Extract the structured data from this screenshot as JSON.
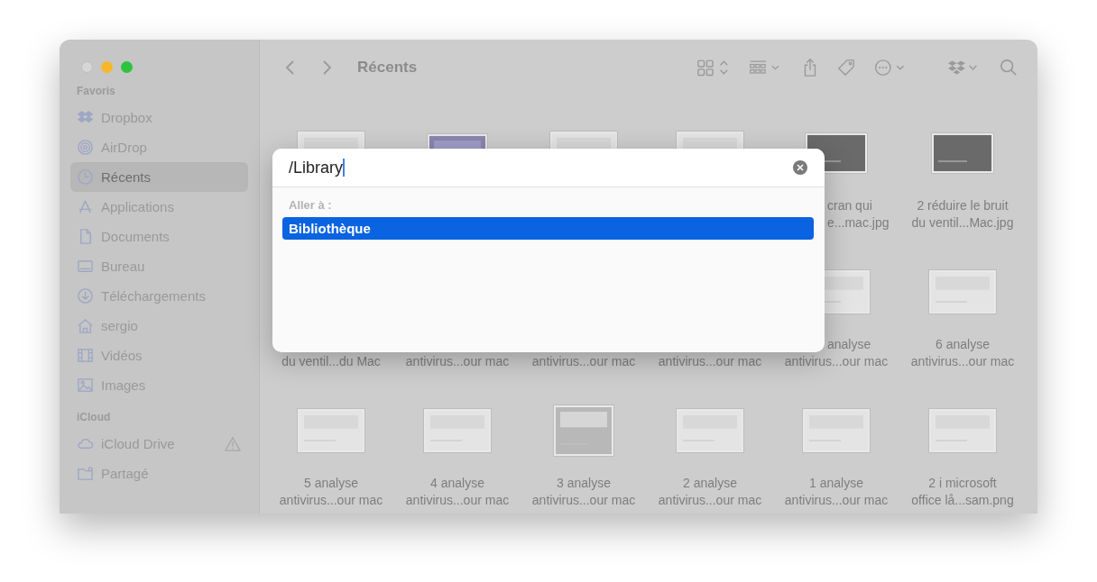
{
  "window": {
    "title": "Récents"
  },
  "sidebar": {
    "sections": [
      {
        "header": "Favoris",
        "items": [
          {
            "label": "Dropbox",
            "selected": false
          },
          {
            "label": "AirDrop",
            "selected": false
          },
          {
            "label": "Récents",
            "selected": true
          },
          {
            "label": "Applications",
            "selected": false
          },
          {
            "label": "Documents",
            "selected": false
          },
          {
            "label": "Bureau",
            "selected": false
          },
          {
            "label": "Téléchargements",
            "selected": false
          },
          {
            "label": "sergio",
            "selected": false
          },
          {
            "label": "Vidéos",
            "selected": false
          },
          {
            "label": "Images",
            "selected": false
          }
        ]
      },
      {
        "header": "iCloud",
        "items": [
          {
            "label": "iCloud Drive",
            "selected": false,
            "warning": true
          },
          {
            "label": "Partagé",
            "selected": false
          }
        ]
      }
    ]
  },
  "files": [
    {
      "kind": "doc"
    },
    {
      "kind": "purple"
    },
    {
      "kind": "doc"
    },
    {
      "kind": "doc"
    },
    {
      "kind": "dark",
      "line1": {
        "text": "cran qui",
        "cut_left": true
      },
      "line2": {
        "text": "e...mac.jpg",
        "cut_left": true
      }
    },
    {
      "kind": "dark",
      "line1": {
        "text": "2 réduire le bruit"
      },
      "line2": {
        "text": "du ventil...Mac.jpg"
      }
    },
    {
      "kind": "covered",
      "line2": {
        "text": "du ventil...du Mac"
      }
    },
    {
      "kind": "covered",
      "line2": {
        "text": "antivirus...our mac"
      }
    },
    {
      "kind": "covered",
      "line2": {
        "text": "antivirus...our mac"
      }
    },
    {
      "kind": "covered",
      "line2": {
        "text": "antivirus...our mac"
      }
    },
    {
      "kind": "doc",
      "line1": {
        "text": "analyse",
        "cut_left": true
      },
      "line2": {
        "text": "antivirus...our mac"
      }
    },
    {
      "kind": "doc",
      "line1": {
        "text": "6 analyse"
      },
      "line2": {
        "text": "antivirus...our mac"
      }
    },
    {
      "kind": "doc",
      "line1": {
        "text": "5 analyse"
      },
      "line2": {
        "text": "antivirus...our mac"
      }
    },
    {
      "kind": "doc",
      "line1": {
        "text": "4 analyse"
      },
      "line2": {
        "text": "antivirus...our mac"
      }
    },
    {
      "kind": "grey",
      "line1": {
        "text": "3 analyse"
      },
      "line2": {
        "text": "antivirus...our mac"
      }
    },
    {
      "kind": "doc",
      "line1": {
        "text": "2 analyse"
      },
      "line2": {
        "text": "antivirus...our mac"
      }
    },
    {
      "kind": "doc",
      "line1": {
        "text": "1 analyse"
      },
      "line2": {
        "text": "antivirus...our mac"
      }
    },
    {
      "kind": "doc",
      "line1": {
        "text": "2 i microsoft"
      },
      "line2": {
        "text": "office lå...sam.png"
      }
    }
  ],
  "dialog": {
    "value": "/Library",
    "section_label": "Aller à :",
    "results": [
      {
        "label": "Bibliothèque",
        "selected": true
      }
    ]
  }
}
